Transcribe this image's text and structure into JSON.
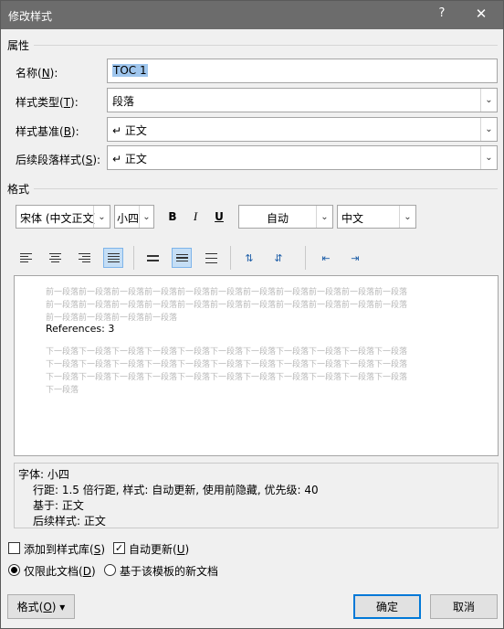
{
  "window": {
    "title": "修改样式",
    "help": "?",
    "close": "✕"
  },
  "properties": {
    "section": "属性",
    "name_label_pre": "名称(",
    "name_label_key": "N",
    "name_label_post": "):",
    "name_value": "TOC 1",
    "type_label_pre": "样式类型(",
    "type_label_key": "T",
    "type_label_post": "):",
    "type_value": "段落",
    "based_label_pre": "样式基准(",
    "based_label_key": "B",
    "based_label_post": "):",
    "based_value": "↵ 正文",
    "next_label_pre": "后续段落样式(",
    "next_label_key": "S",
    "next_label_post": "):",
    "next_value": "↵ 正文"
  },
  "format": {
    "section": "格式",
    "font": "宋体 (中文正文)",
    "size": "小四",
    "bold": "B",
    "italic": "I",
    "underline": "U",
    "color": "自动",
    "language": "中文"
  },
  "preview": {
    "prev_lines": [
      "前一段落前一段落前一段落前一段落前一段落前一段落前一段落前一段落前一段落前一段落前一段落",
      "前一段落前一段落前一段落前一段落前一段落前一段落前一段落前一段落前一段落前一段落前一段落",
      "前一段落前一段落前一段落前一段落"
    ],
    "sample": "References:   3",
    "next_lines": [
      "下一段落下一段落下一段落下一段落下一段落下一段落下一段落下一段落下一段落下一段落下一段落",
      "下一段落下一段落下一段落下一段落下一段落下一段落下一段落下一段落下一段落下一段落下一段落",
      "下一段落下一段落下一段落下一段落下一段落下一段落下一段落下一段落下一段落下一段落下一段落",
      "下一段落"
    ]
  },
  "description": {
    "line1": "字体: 小四",
    "line2": "行距: 1.5 倍行距, 样式: 自动更新, 使用前隐藏, 优先级: 40",
    "line3": "基于: 正文",
    "line4": "后续样式: 正文"
  },
  "options": {
    "add_gallery_pre": "添加到样式库(",
    "add_gallery_key": "S",
    "add_gallery_post": ")",
    "add_gallery_checked": false,
    "auto_update_pre": "自动更新(",
    "auto_update_key": "U",
    "auto_update_post": ")",
    "auto_update_checked": true,
    "only_doc_pre": "仅限此文档(",
    "only_doc_key": "D",
    "only_doc_post": ")",
    "template_docs": "基于该模板的新文档"
  },
  "buttons": {
    "format_pre": "格式(",
    "format_key": "O",
    "format_post": ") ▾",
    "ok": "确定",
    "cancel": "取消"
  },
  "colors": {
    "titlebar": "#6c6c6c",
    "selection": "#9fc6ee",
    "active_button": "#c5def5",
    "focus_border": "#0078d7"
  }
}
